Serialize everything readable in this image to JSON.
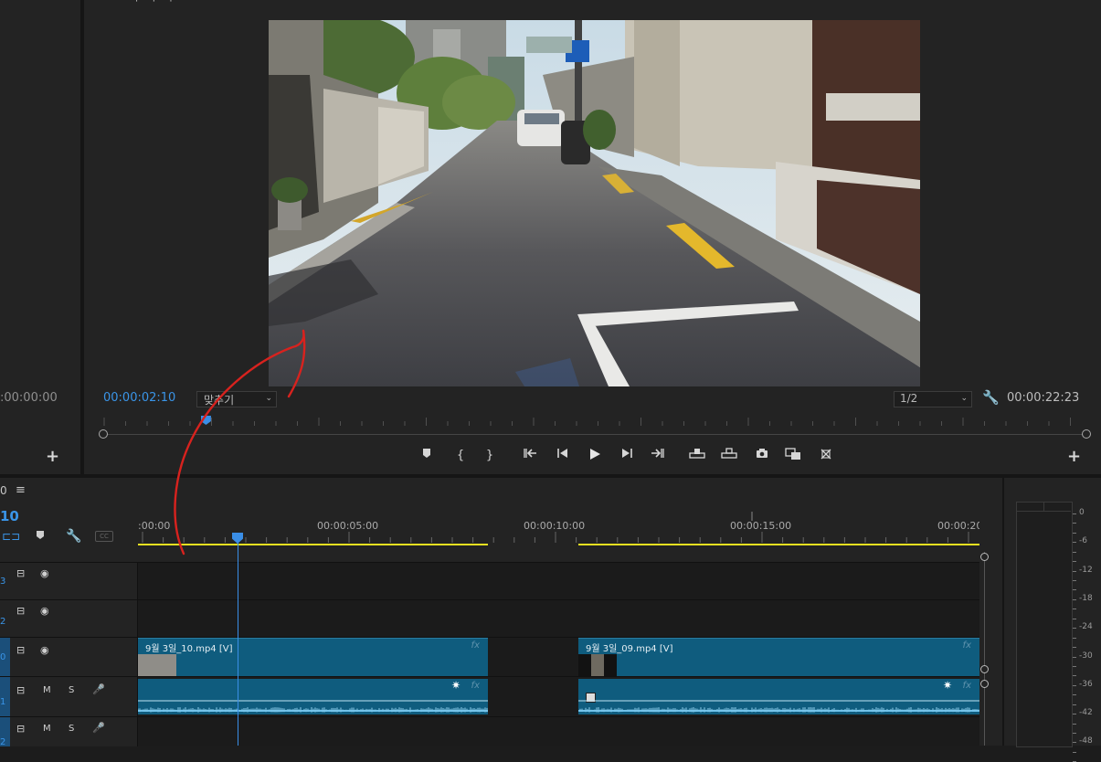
{
  "left_panel": {
    "timecode": ":00:00:00",
    "add_label": "+"
  },
  "top_partial_icons": "⌐ ⌐ ⌐",
  "program_monitor": {
    "playhead_timecode": "00:00:02:10",
    "fit_label": "맞추기",
    "resolution_label": "1/2",
    "duration_timecode": "00:00:22:23",
    "playhead_fraction": 0.104,
    "add_label": "+",
    "transport_icons": {
      "add_marker": "marker-icon",
      "mark_in": "mark-in-icon",
      "mark_out": "mark-out-icon",
      "go_to_in": "go-to-in-icon",
      "step_back": "step-back-icon",
      "play": "play-icon",
      "step_forward": "step-forward-icon",
      "go_to_out": "go-to-out-icon",
      "lift": "lift-icon",
      "extract": "extract-icon",
      "export_frame": "camera-icon",
      "compare_view": "comparison-view-icon",
      "proxy_toggle": "proxy-icon"
    }
  },
  "timeline": {
    "tab_number": "0",
    "current_time": "10",
    "ruler_labels": [
      ":00:00",
      "00:00:05:00",
      "00:00:10:00",
      "00:00:15:00",
      "00:00:20"
    ],
    "cc_label": "CC",
    "tracks": [
      {
        "id": "V3",
        "label": "3",
        "type": "video"
      },
      {
        "id": "V2",
        "label": "2",
        "type": "video"
      },
      {
        "id": "V1",
        "label": "0",
        "type": "video"
      },
      {
        "id": "A1",
        "label": "1",
        "type": "audio",
        "mute": "M",
        "solo": "S"
      },
      {
        "id": "A2",
        "label": "2",
        "type": "audio",
        "mute": "M",
        "solo": "S"
      }
    ],
    "video_clips": [
      {
        "name": "9월 3일_10.mp4 [V]",
        "fx": "fx"
      },
      {
        "name": "9월 3일_09.mp4 [V]",
        "fx": "fx"
      }
    ],
    "audio_clips": [
      {
        "fx": "fx"
      },
      {
        "fx": "fx"
      }
    ]
  },
  "audio_meter": {
    "labels": [
      "0",
      "-6",
      "-12",
      "-18",
      "-24",
      "-30",
      "-36",
      "-42",
      "-48"
    ]
  },
  "colors": {
    "accent_blue": "#3a95e8",
    "clip_teal": "#0f5c7e",
    "work_area_yellow": "#e6e020",
    "annotation_red": "#d8221e"
  }
}
